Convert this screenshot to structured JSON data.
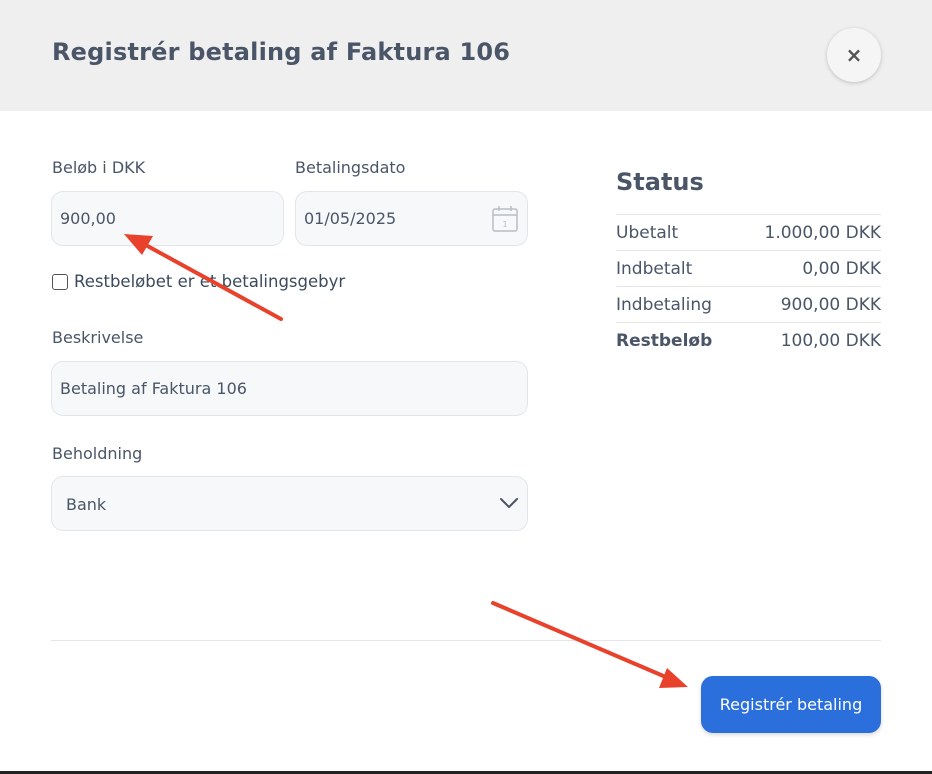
{
  "modal": {
    "title": "Registrér betaling af Faktura 106",
    "close_symbol": "×"
  },
  "form": {
    "amount_label": "Beløb i DKK",
    "amount_value": "900,00",
    "date_label": "Betalingsdato",
    "date_value": "01/05/2025",
    "calendar_day": "1",
    "fee_checkbox_label": "Restbeløbet er et betalingsgebyr",
    "fee_checked": false,
    "description_label": "Beskrivelse",
    "description_value": "Betaling af Faktura 106",
    "holding_label": "Beholdning",
    "holding_value": "Bank"
  },
  "status": {
    "title": "Status",
    "rows": [
      {
        "label": "Ubetalt",
        "value": "1.000,00 DKK"
      },
      {
        "label": "Indbetalt",
        "value": "0,00 DKK"
      },
      {
        "label": "Indbetaling",
        "value": "900,00 DKK"
      },
      {
        "label": "Restbeløb",
        "value": "100,00 DKK"
      }
    ]
  },
  "footer": {
    "submit_label": "Registrér betaling"
  },
  "colors": {
    "accent": "#2a6fdb",
    "annotation_arrow": "#e8412c"
  },
  "icons": {
    "close": "close-icon",
    "calendar": "calendar-icon",
    "dropdown": "chevron-down-icon",
    "annotation": "arrow-annotation-icon"
  }
}
